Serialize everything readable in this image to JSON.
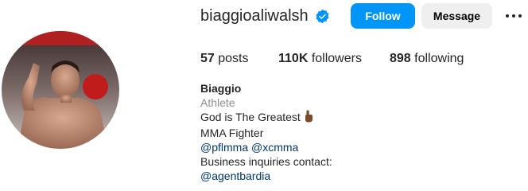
{
  "profile": {
    "username": "biaggioaliwalsh",
    "verified_icon": "verified-badge-icon",
    "follow_label": "Follow",
    "message_label": "Message",
    "more_icon": "more-options-icon"
  },
  "stats": {
    "posts_count": "57",
    "posts_label": "posts",
    "followers_count": "110K",
    "followers_label": "followers",
    "following_count": "898",
    "following_label": "following"
  },
  "bio": {
    "name": "Biaggio",
    "category": "Athlete",
    "line1": "God is The Greatest",
    "line1_emoji_icon": "pointing-up-hand-icon",
    "line2": "MMA Fighter",
    "mention1": "@pflmma",
    "mention2": "@xcmma",
    "line4": "Business inquiries contact:",
    "contact_mention": "@agentbardia"
  },
  "colors": {
    "follow_button": "#0095f6",
    "message_button": "#efefef",
    "verified": "#0095f6",
    "link": "#00376b",
    "category": "#8e8e8e"
  }
}
